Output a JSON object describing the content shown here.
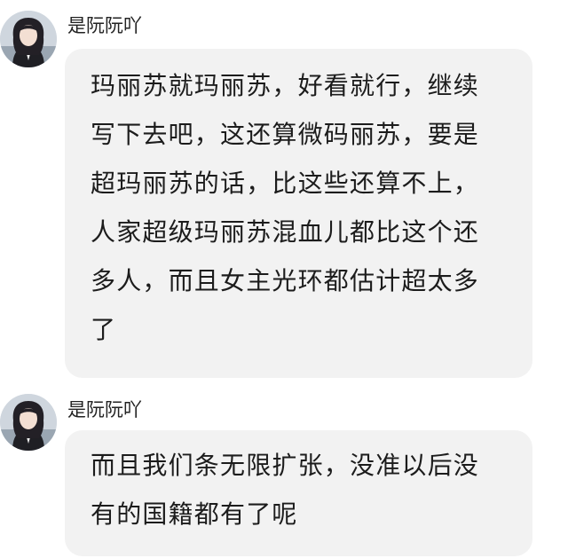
{
  "messages": [
    {
      "username": "是阮阮吖",
      "avatar_icon": "user-avatar-icon",
      "lines": [
        "玛丽苏就玛丽苏，好看就行，继续",
        "写下去吧，这还算微码丽苏，要是",
        "超玛丽苏的话，比这些还算不上，",
        "人家超级玛丽苏混血儿都比这个还",
        "多人，而且女主光环都估计超太多",
        "了"
      ]
    },
    {
      "username": "是阮阮吖",
      "avatar_icon": "user-avatar-icon",
      "lines": [
        "而且我们条无限扩张，没准以后没",
        "有的国籍都有了呢"
      ]
    }
  ],
  "colors": {
    "bubble_bg": "#f2f2f2",
    "text": "#1c1c1c",
    "username": "#222222"
  }
}
